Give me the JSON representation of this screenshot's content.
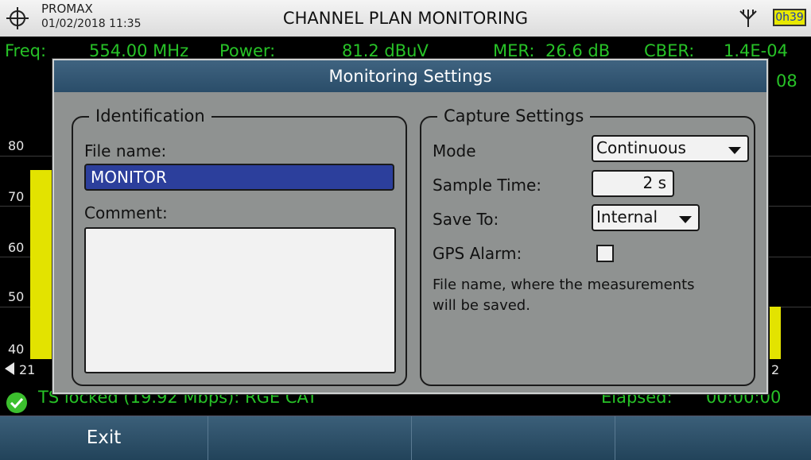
{
  "titlebar": {
    "brand": "PROMAX",
    "datetime": "01/02/2018 11:35",
    "title": "CHANNEL PLAN MONITORING",
    "battery": "0h39"
  },
  "background": {
    "freq_label": "Freq:",
    "freq_value": "554.00 MHz",
    "power_label": "Power:",
    "power_value": "81.2 dBuV",
    "mer_label": "MER:",
    "mer_value": "26.6 dB",
    "cber_label": "CBER:",
    "cber_value": "1.4E-04",
    "cber_extra": "08",
    "y_labels": [
      "80",
      "70",
      "60",
      "50",
      "40"
    ],
    "x_left": "21",
    "x_right": "2",
    "status_text": "TS locked (19.92 Mbps): RGE CAT",
    "elapsed_label": "Elapsed:",
    "elapsed_value": "00:00:00"
  },
  "softkeys": [
    "Exit",
    "",
    "",
    ""
  ],
  "dialog": {
    "title": "Monitoring Settings",
    "identification": {
      "group_title": "Identification",
      "file_name_label": "File name:",
      "file_name_value": "MONITOR",
      "comment_label": "Comment:",
      "comment_value": ""
    },
    "capture": {
      "group_title": "Capture Settings",
      "mode_label": "Mode",
      "mode_value": "Continuous",
      "sample_time_label": "Sample Time:",
      "sample_time_value": "2 s",
      "save_to_label": "Save To:",
      "save_to_value": "Internal",
      "gps_alarm_label": "GPS Alarm:",
      "gps_alarm_checked": false,
      "help_text": "File name, where the measurements will be saved."
    }
  }
}
